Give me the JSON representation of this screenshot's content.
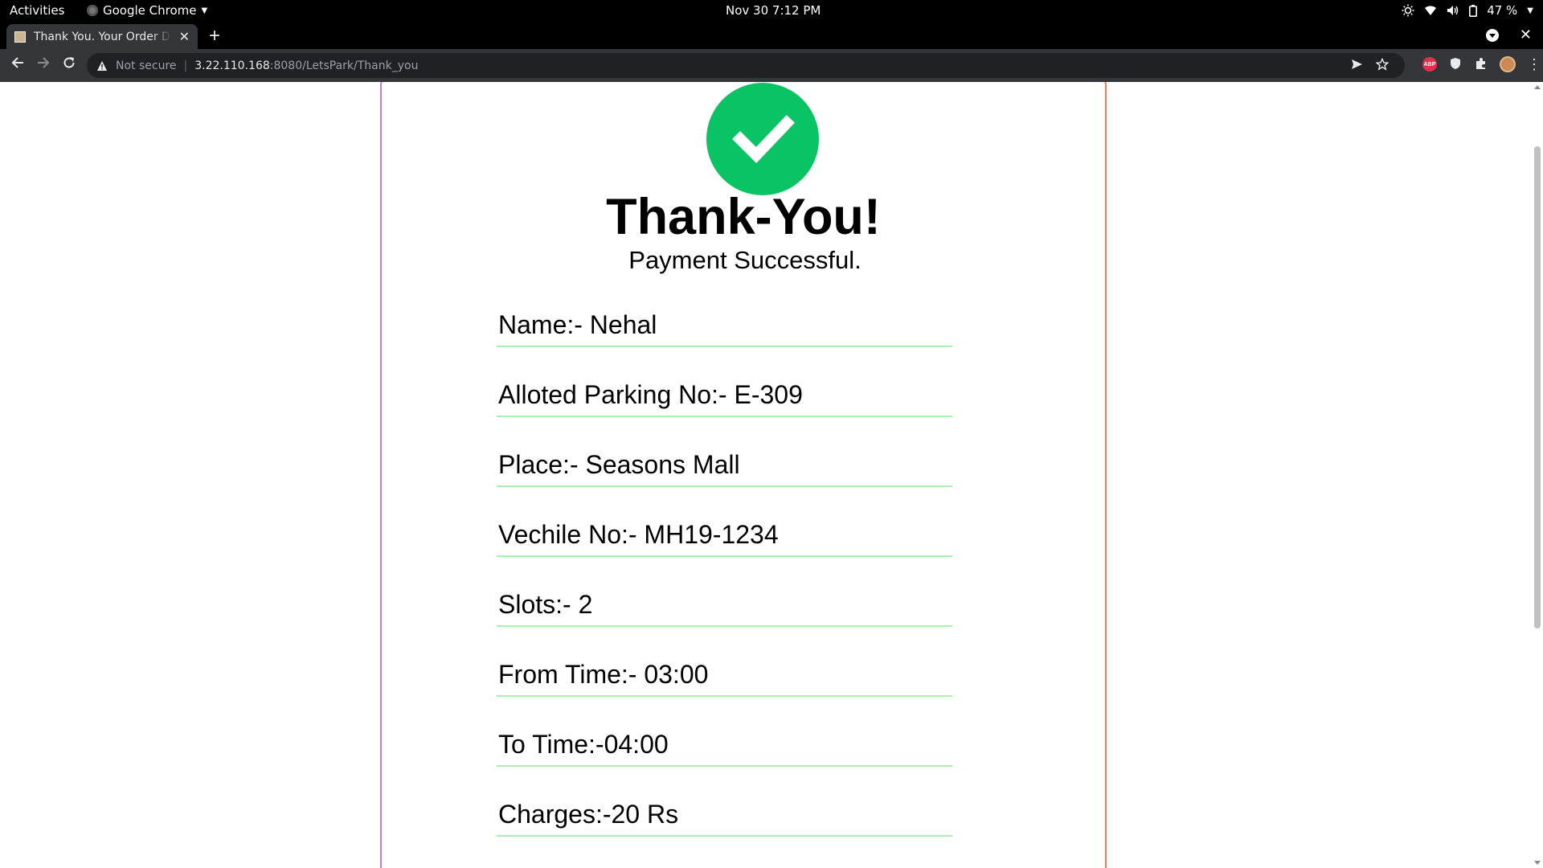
{
  "system_bar": {
    "activities": "Activities",
    "app_name": "Google Chrome",
    "datetime": "Nov 30  7:12 PM",
    "battery": "47 %"
  },
  "browser": {
    "tab_title": "Thank You. Your Order Details",
    "url_security": "Not secure",
    "url_host": "3.22.110.168",
    "url_rest": ":8080/LetsPark/Thank_you",
    "extensions": [
      "adblock-plus-icon",
      "shield-icon",
      "puzzle-icon",
      "profile-avatar"
    ],
    "abp_label": "ABP"
  },
  "page": {
    "title": "Thank-You!",
    "subtitle": "Payment Successful.",
    "details": [
      {
        "text": "Name:- Nehal"
      },
      {
        "text": "Alloted Parking No:- E-309"
      },
      {
        "text": "Place:- Seasons Mall"
      },
      {
        "text": "Vechile No:- MH19-1234"
      },
      {
        "text": "Slots:- 2"
      },
      {
        "text": "From Time:- 03:00"
      },
      {
        "text": "To Time:-04:00"
      },
      {
        "text": "Charges:-20 Rs"
      }
    ]
  },
  "colors": {
    "success_green": "#0ac364",
    "underline_green": "#a9efb2",
    "border_gradient_start": "#c77be0",
    "border_gradient_end": "#f07a4a"
  }
}
